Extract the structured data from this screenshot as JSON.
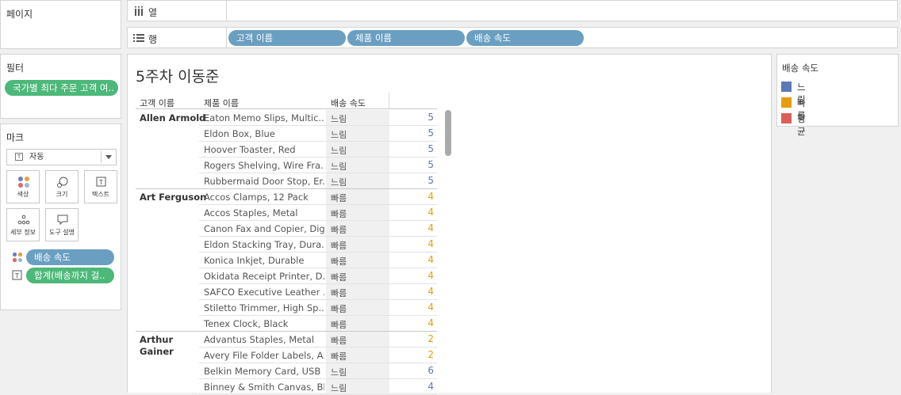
{
  "left_panel": {
    "pages_title": "페이지",
    "filters_title": "필터",
    "filter_pill": "국가별 최다 주문 고객 여..",
    "marks_title": "마크",
    "mark_type": "자동",
    "mark_buttons": [
      "색상",
      "크기",
      "텍스트",
      "세부 정보",
      "도구 설명"
    ],
    "mark_fields": [
      "배송 속도",
      "합계(배송까지 걸.."
    ]
  },
  "shelves": {
    "columns_label": "열",
    "rows_label": "행",
    "row_pills": [
      "고객 이름",
      "제품 이름",
      "배송 속도"
    ]
  },
  "sheet": {
    "title": "5주차 이동준",
    "headers": [
      "고객 이름",
      "제품 이름",
      "배송 속도"
    ],
    "groups": [
      {
        "customer": "Allen Armold",
        "rows": [
          {
            "product": "Eaton Memo Slips, Multic..",
            "speed": "느림",
            "value": "5"
          },
          {
            "product": "Eldon Box, Blue",
            "speed": "느림",
            "value": "5"
          },
          {
            "product": "Hoover Toaster, Red",
            "speed": "느림",
            "value": "5"
          },
          {
            "product": "Rogers Shelving, Wire Fra..",
            "speed": "느림",
            "value": "5"
          },
          {
            "product": "Rubbermaid Door Stop, Er..",
            "speed": "느림",
            "value": "5"
          }
        ]
      },
      {
        "customer": "Art Ferguson",
        "rows": [
          {
            "product": "Accos Clamps, 12 Pack",
            "speed": "빠름",
            "value": "4"
          },
          {
            "product": "Accos Staples, Metal",
            "speed": "빠름",
            "value": "4"
          },
          {
            "product": "Canon Fax and Copier, Dig..",
            "speed": "빠름",
            "value": "4"
          },
          {
            "product": "Eldon Stacking Tray, Dura..",
            "speed": "빠름",
            "value": "4"
          },
          {
            "product": "Konica Inkjet, Durable",
            "speed": "빠름",
            "value": "4"
          },
          {
            "product": "Okidata Receipt Printer, D..",
            "speed": "빠름",
            "value": "4"
          },
          {
            "product": "SAFCO Executive Leather ..",
            "speed": "빠름",
            "value": "4"
          },
          {
            "product": "Stiletto Trimmer, High Sp..",
            "speed": "빠름",
            "value": "4"
          },
          {
            "product": "Tenex Clock, Black",
            "speed": "빠름",
            "value": "4"
          }
        ]
      },
      {
        "customer": "Arthur Gainer",
        "customer_lines": [
          "Arthur",
          "Gainer"
        ],
        "rows": [
          {
            "product": "Advantus Staples, Metal",
            "speed": "빠름",
            "value": "2"
          },
          {
            "product": "Avery File Folder Labels, A..",
            "speed": "빠름",
            "value": "2"
          },
          {
            "product": "Belkin Memory Card, USB",
            "speed": "느림",
            "value": "6"
          },
          {
            "product": "Binney & Smith Canvas, Bl..",
            "speed": "느림",
            "value": "4"
          }
        ]
      }
    ]
  },
  "legend": {
    "title": "배송 속도",
    "items": [
      {
        "label": "느림",
        "color": "#5b79b5"
      },
      {
        "label": "빠름",
        "color": "#e79b10"
      },
      {
        "label": "평균",
        "color": "#d9605a"
      }
    ]
  },
  "colors": {
    "느림": "#5b79b5",
    "빠름": "#e79b10",
    "평균": "#d9605a"
  }
}
